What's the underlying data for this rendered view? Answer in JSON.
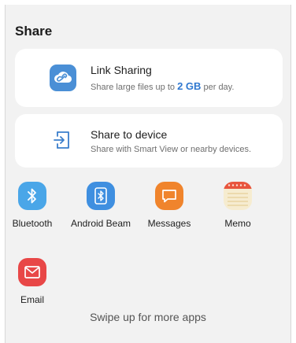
{
  "header": {
    "title": "Share"
  },
  "link_sharing": {
    "icon": "cloud-link-icon",
    "title": "Link Sharing",
    "subtitle_prefix": "Share large files up to",
    "subtitle_highlight": "2 GB",
    "subtitle_suffix": "per day."
  },
  "share_to_device": {
    "icon": "share-to-device-icon",
    "title": "Share to device",
    "subtitle": "Share with Smart View or nearby devices."
  },
  "apps": [
    {
      "label": "Bluetooth",
      "icon": "bluetooth-icon",
      "color": "#4aa6e8"
    },
    {
      "label": "Android Beam",
      "icon": "android-beam-icon",
      "color": "#3f8fe0"
    },
    {
      "label": "Messages",
      "icon": "messages-icon",
      "color": "#f0842c"
    },
    {
      "label": "Memo",
      "icon": "memo-icon",
      "color": "#f6ecd0"
    },
    {
      "label": "Email",
      "icon": "email-icon",
      "color": "#e84747"
    }
  ],
  "footer": {
    "hint": "Swipe up for more apps"
  },
  "colors": {
    "accent": "#2f78d0",
    "background": "#f2f2f2"
  }
}
